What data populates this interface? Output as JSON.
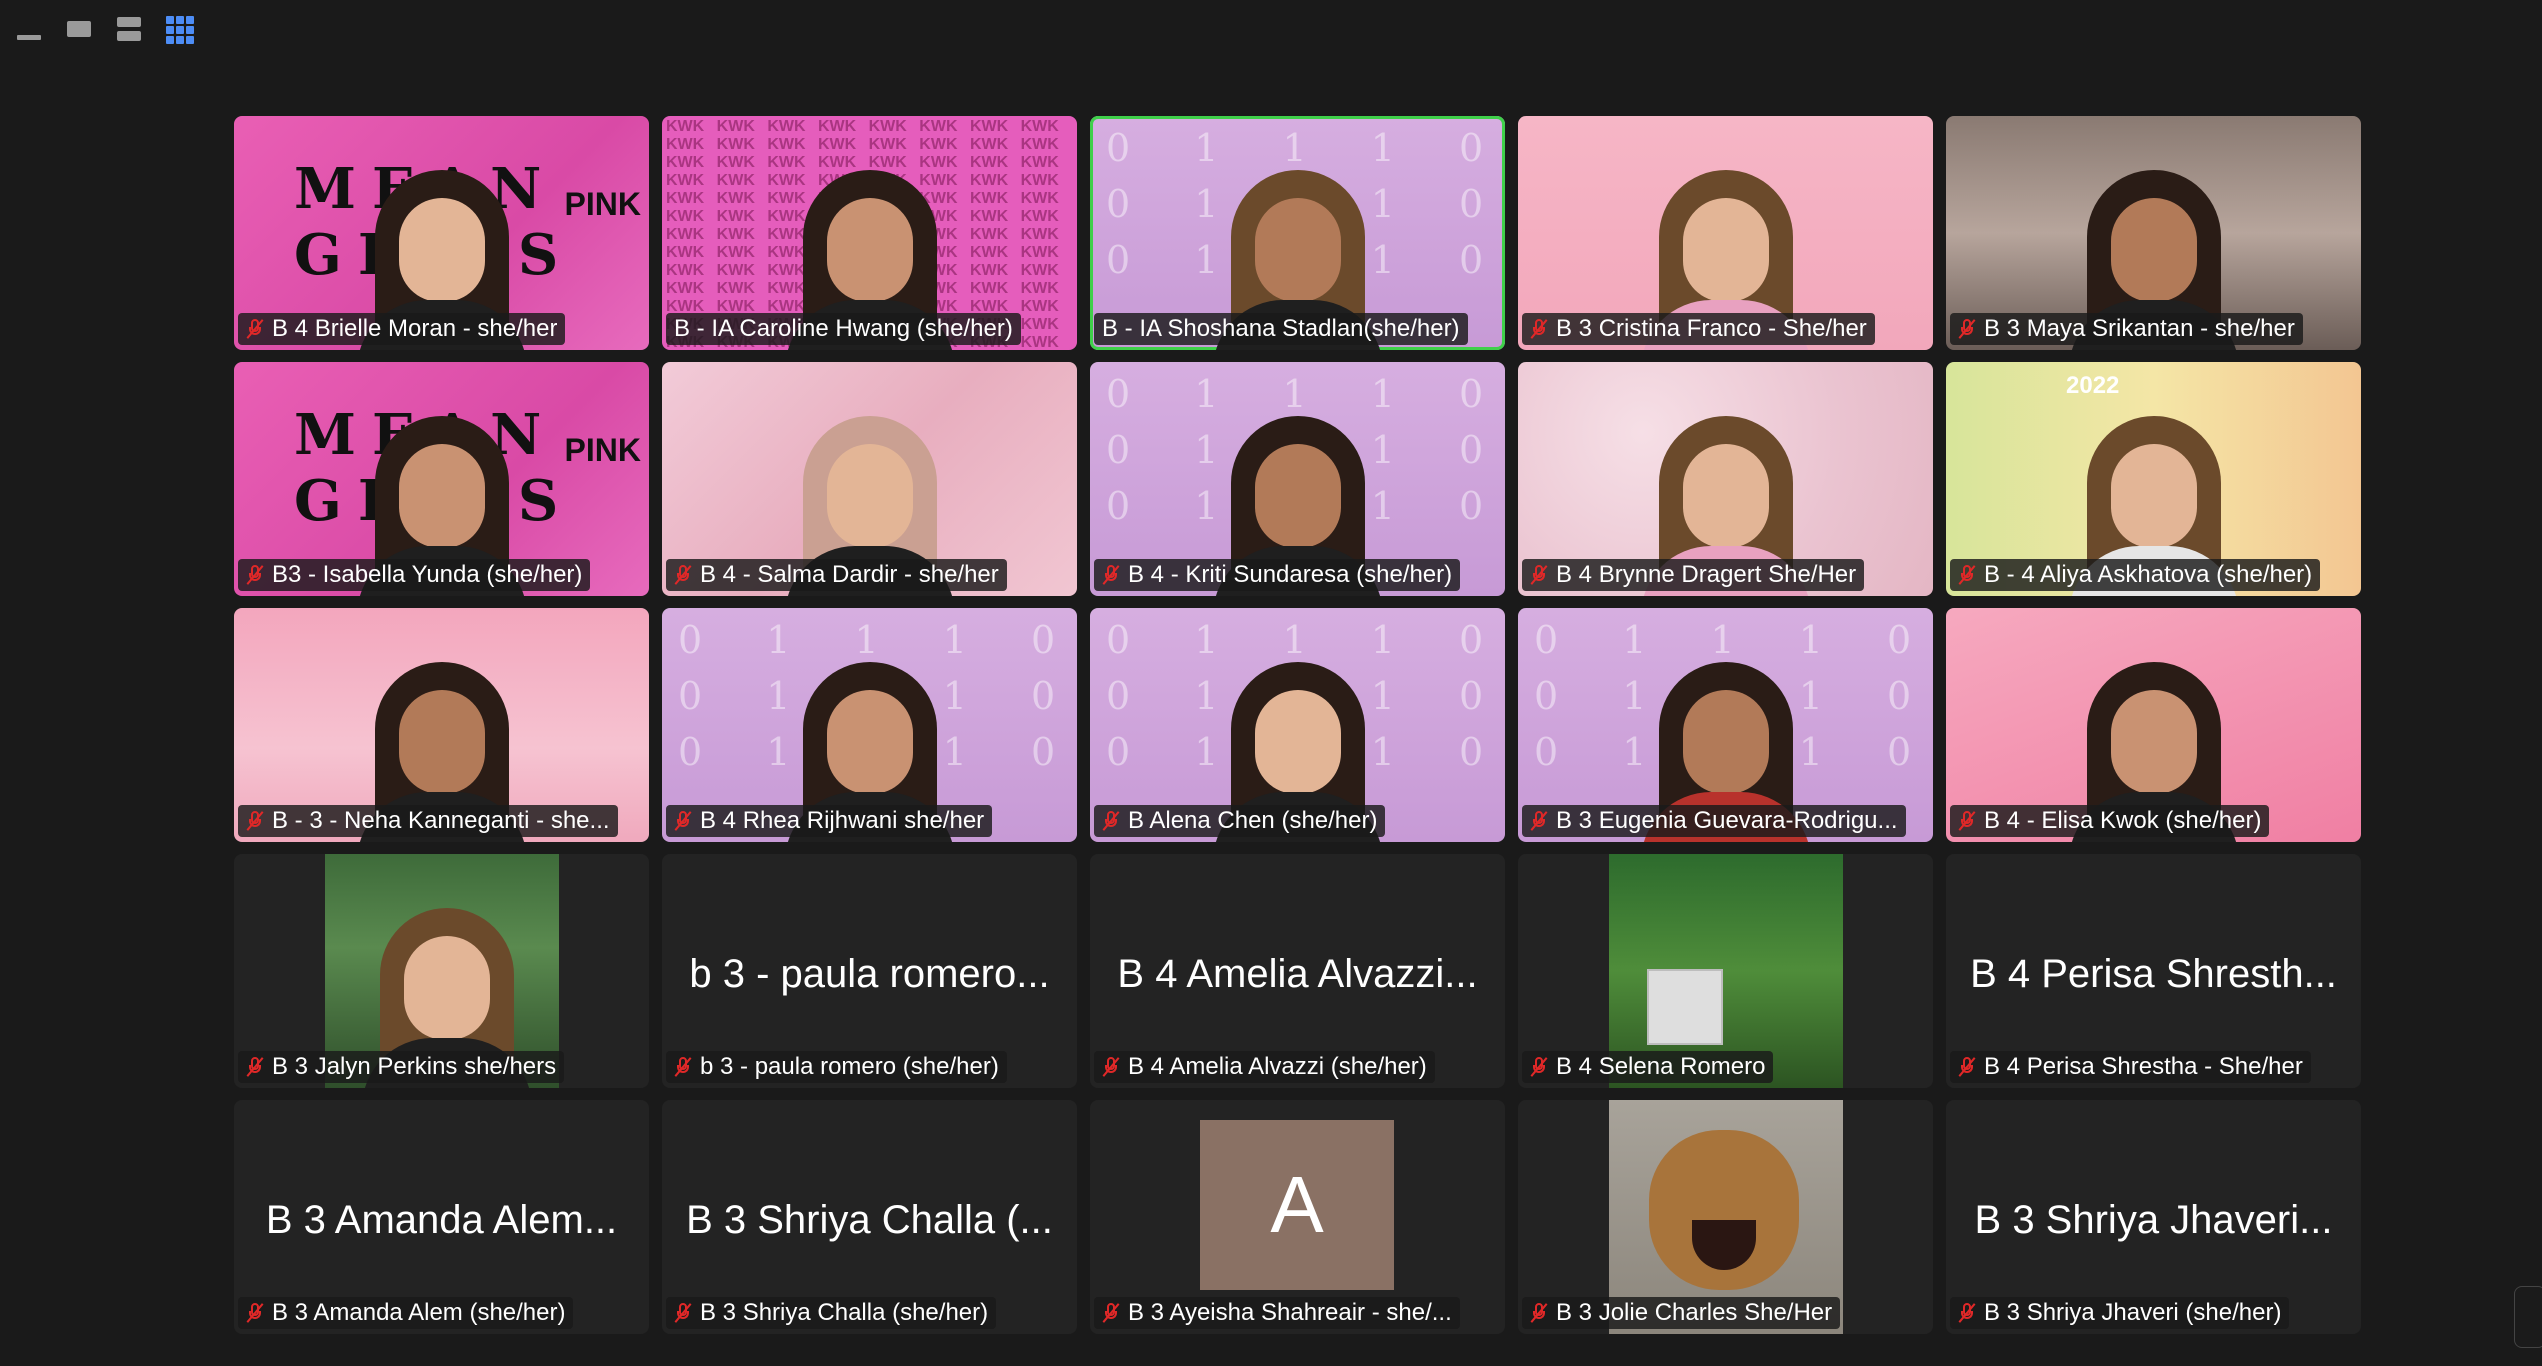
{
  "toolbar": {
    "views": [
      {
        "name": "speaker-view"
      },
      {
        "name": "single-view"
      },
      {
        "name": "stacked-view"
      },
      {
        "name": "gallery-view",
        "active": true
      }
    ]
  },
  "accent_colors": {
    "active_speaker": "#3fd04a",
    "muted": "#e02828",
    "gallery_icon": "#4d8df6"
  },
  "tiles": [
    {
      "label": "B  4  Brielle Moran - she/her",
      "muted": true,
      "kind": "video",
      "bg": "meangirls",
      "logo": "MEAN GIRLS",
      "side": "PINK"
    },
    {
      "label": "B - IA Caroline Hwang (she/her)",
      "muted": false,
      "kind": "video",
      "bg": "kwk",
      "pattern": "KWK"
    },
    {
      "label": "B - IA  Shoshana Stadlan(she/her)",
      "muted": false,
      "kind": "video",
      "bg": "binary",
      "active": true,
      "binary": "0 1 1 1 0 0 0 0"
    },
    {
      "label": "B 3 Cristina Franco - She/her",
      "muted": true,
      "kind": "video",
      "bg": "pink"
    },
    {
      "label": "B 3 Maya Srikantan - she/her",
      "muted": true,
      "kind": "video",
      "bg": "mall"
    },
    {
      "label": "B3 - Isabella Yunda (she/her)",
      "muted": true,
      "kind": "video",
      "bg": "meangirls",
      "logo": "MEAN GIRLS",
      "side": "PINK"
    },
    {
      "label": "B 4 - Salma Dardir - she/her",
      "muted": true,
      "kind": "video",
      "bg": "pinkwater"
    },
    {
      "label": "B 4 - Kriti Sundaresa (she/her)",
      "muted": true,
      "kind": "video",
      "bg": "binary",
      "binary": "0 1 1 1 0 0 0 0"
    },
    {
      "label": "B 4 Brynne Dragert She/Her",
      "muted": true,
      "kind": "video",
      "bg": "sparkle"
    },
    {
      "label": "B - 4 Aliya Askhatova (she/her)",
      "muted": true,
      "kind": "video",
      "bg": "yellow",
      "year": "2022"
    },
    {
      "label": "B - 3 - Neha Kanneganti - she...",
      "muted": true,
      "kind": "video",
      "bg": "clouds"
    },
    {
      "label": "B  4  Rhea Rijhwani she/her",
      "muted": true,
      "kind": "video",
      "bg": "binary",
      "binary": "0 1 1 1 0 0 0 0"
    },
    {
      "label": "B Alena Chen (she/her)",
      "muted": true,
      "kind": "video",
      "bg": "binary",
      "binary": "0 1 1 1 0 0 0 0"
    },
    {
      "label": "B 3 Eugenia Guevara-Rodrigu...",
      "muted": true,
      "kind": "video",
      "bg": "binary",
      "binary": "0 1 1 1 0 0 0 0"
    },
    {
      "label": "B 4 - Elisa Kwok (she/her)",
      "muted": true,
      "kind": "video",
      "bg": "brightpink"
    },
    {
      "label": "B 3 Jalyn Perkins she/hers",
      "muted": true,
      "kind": "photo",
      "photo": "garden"
    },
    {
      "label": "b 3 - paula romero (she/her)",
      "muted": true,
      "kind": "name",
      "big": "b 3 - paula romero..."
    },
    {
      "label": "B 4 Amelia Alvazzi (she/her)",
      "muted": true,
      "kind": "name",
      "big": "B 4 Amelia Alvazzi..."
    },
    {
      "label": "B 4 Selena Romero",
      "muted": true,
      "kind": "photo",
      "photo": "minecraft"
    },
    {
      "label": "B 4 Perisa Shrestha - She/her",
      "muted": true,
      "kind": "name",
      "big": "B 4 Perisa Shresth..."
    },
    {
      "label": "B 3 Amanda Alem (she/her)",
      "muted": true,
      "kind": "name",
      "big": "B 3 Amanda Alem..."
    },
    {
      "label": "B 3 Shriya Challa (she/her)",
      "muted": true,
      "kind": "name",
      "big": "B 3 Shriya Challa (..."
    },
    {
      "label": "B  3  Ayeisha Shahreair - she/...",
      "muted": true,
      "kind": "avatar",
      "initial": "A"
    },
    {
      "label": "B  3  Jolie Charles She/Her",
      "muted": true,
      "kind": "photo",
      "photo": "dog"
    },
    {
      "label": "B 3 Shriya Jhaveri (she/her)",
      "muted": true,
      "kind": "name",
      "big": "B 3 Shriya Jhaveri..."
    }
  ]
}
